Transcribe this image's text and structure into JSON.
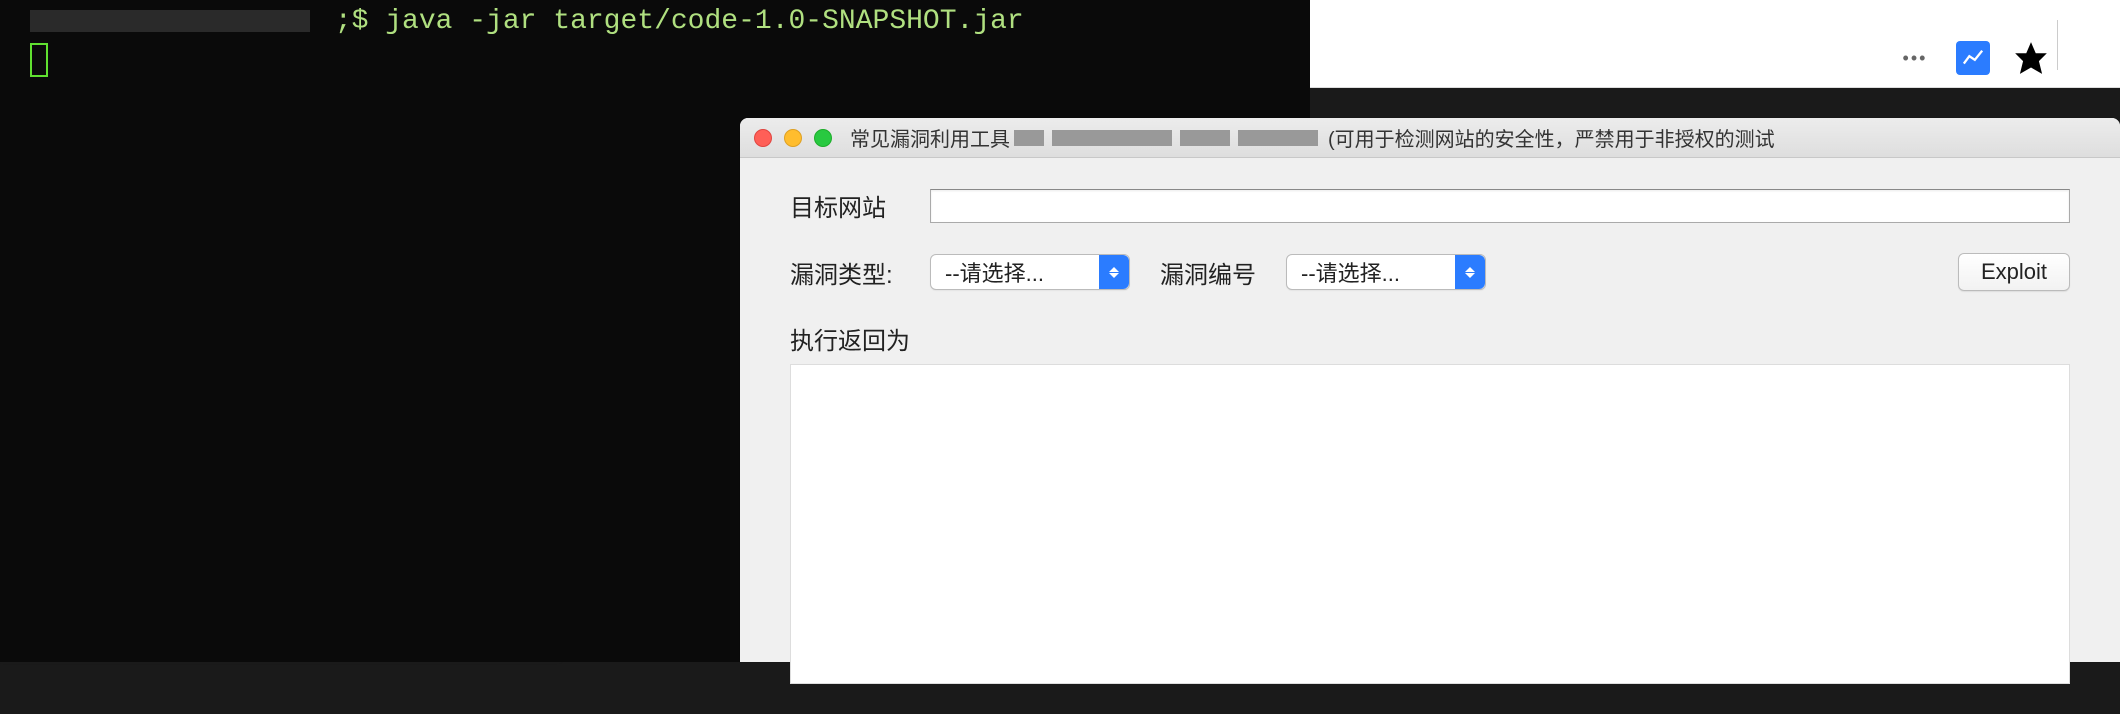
{
  "terminal": {
    "prompt_suffix": ";$",
    "command": "java -jar target/code-1.0-SNAPSHOT.jar"
  },
  "browser": {
    "icons": {
      "menu": "more-menu",
      "chart": "pocket-chart-icon",
      "star": "bookmark-star",
      "pocket": "library-icon"
    }
  },
  "app": {
    "title_prefix": "常见漏洞利用工具",
    "title_suffix": "(可用于检测网站的安全性，严禁用于非授权的测试",
    "form": {
      "target_label": "目标网站",
      "target_value": "",
      "vuln_type_label": "漏洞类型:",
      "vuln_type_selected": "--请选择...",
      "vuln_id_label": "漏洞编号",
      "vuln_id_selected": "--请选择...",
      "exploit_button": "Exploit"
    },
    "output_label": "执行返回为"
  }
}
